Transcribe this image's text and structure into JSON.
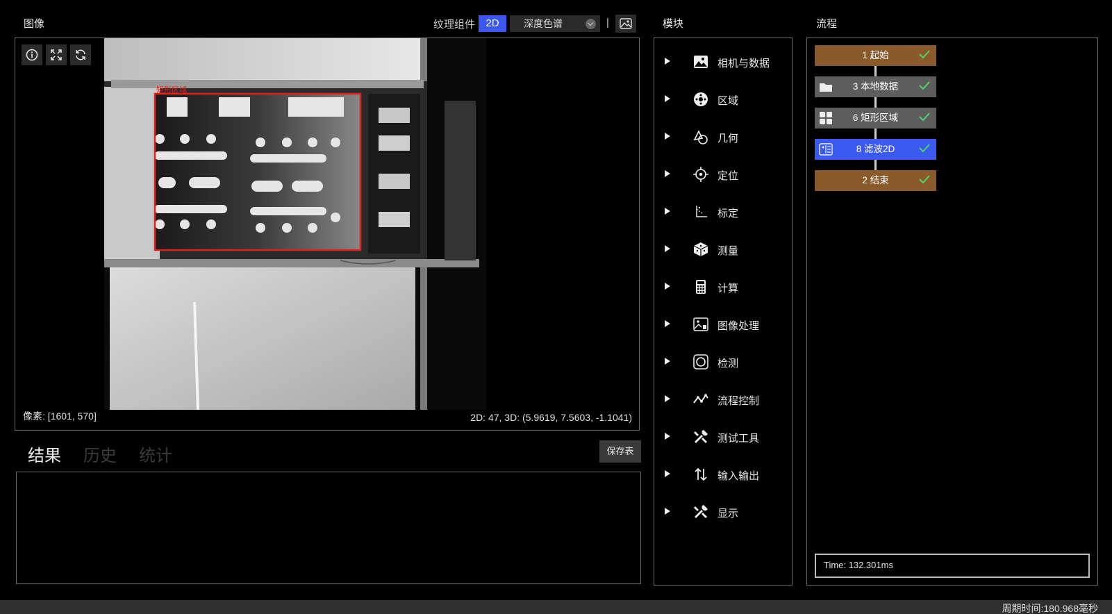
{
  "image_panel": {
    "title": "图像",
    "texture_label": "纹理组件",
    "mode_2d": "2D",
    "colormap_select": "深度色谱",
    "separator": "|",
    "pixel_readout": "像素: [1601, 570]",
    "coord_readout": "2D: 47, 3D: (5.9619, 7.5603, -1.1041)",
    "roi_label": "矩形区域"
  },
  "results": {
    "tabs": [
      {
        "label": "结果"
      },
      {
        "label": "历史"
      },
      {
        "label": "统计"
      }
    ],
    "save_label": "保存表"
  },
  "module_panel": {
    "title": "模块",
    "items": [
      {
        "label": "相机与数据",
        "icon": "image-icon"
      },
      {
        "label": "区域",
        "icon": "region-icon"
      },
      {
        "label": "几何",
        "icon": "geometry-icon"
      },
      {
        "label": "定位",
        "icon": "target-icon"
      },
      {
        "label": "标定",
        "icon": "calibration-icon"
      },
      {
        "label": "测量",
        "icon": "measure-cube-icon"
      },
      {
        "label": "计算",
        "icon": "calculator-icon"
      },
      {
        "label": "图像处理",
        "icon": "image-process-icon"
      },
      {
        "label": "检测",
        "icon": "detect-icon"
      },
      {
        "label": "流程控制",
        "icon": "flow-control-icon"
      },
      {
        "label": "测试工具",
        "icon": "tools-icon"
      },
      {
        "label": "输入输出",
        "icon": "io-icon"
      },
      {
        "label": "显示",
        "icon": "display-tools-icon"
      }
    ]
  },
  "flow_panel": {
    "title": "流程",
    "nodes": [
      {
        "label": "1 起始",
        "color": "#8a5a2b"
      },
      {
        "label": "3 本地数据",
        "color": "#5d5d5d"
      },
      {
        "label": "6 矩形区域",
        "color": "#5d5d5d"
      },
      {
        "label": "8 滤波2D",
        "color": "#3a5af0"
      },
      {
        "label": "2 结束",
        "color": "#8a5a2b"
      }
    ],
    "time": "Time: 132.301ms"
  },
  "status_bar": {
    "cycle_time": "周期时间:180.968毫秒"
  },
  "colors": {
    "accent": "#3b57f0",
    "roi": "#e0201c",
    "check": "#4fd46a"
  }
}
